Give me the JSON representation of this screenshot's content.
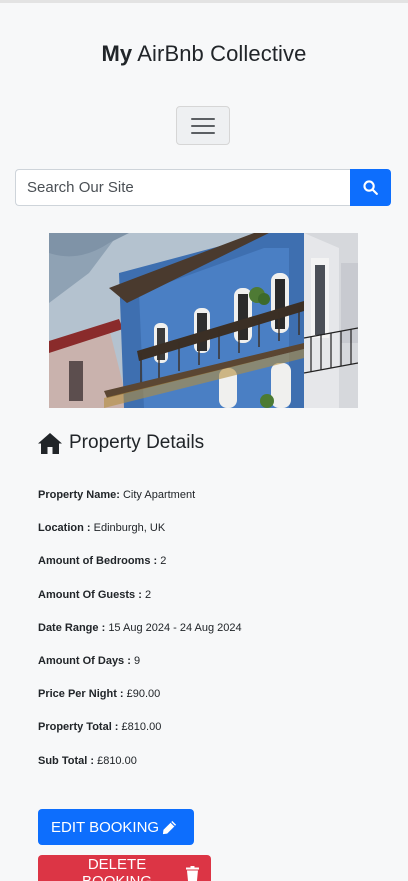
{
  "header": {
    "brand_bold": "My",
    "brand_rest": "AirBnb Collective",
    "menu_icon": "hamburger-menu-icon"
  },
  "search": {
    "placeholder": "Search Our Site",
    "button_icon": "search-icon",
    "button_color": "#0d6efd"
  },
  "property": {
    "heading_icon": "home-icon",
    "heading": "Property Details",
    "details": [
      {
        "label": "Property Name:",
        "value": "City Apartment"
      },
      {
        "label": "Location :",
        "value": "Edinburgh, UK"
      },
      {
        "label": "Amount of Bedrooms :",
        "value": "2"
      },
      {
        "label": "Amount Of Guests :",
        "value": "2"
      },
      {
        "label": "Date Range :",
        "value": "15 Aug 2024 - 24 Aug 2024"
      },
      {
        "label": "Amount Of Days :",
        "value": "9"
      },
      {
        "label": "Price Per Night :",
        "value": "£90.00"
      },
      {
        "label": "Property Total :",
        "value": "£810.00"
      },
      {
        "label": "Sub Total :",
        "value": "£810.00"
      }
    ]
  },
  "actions": {
    "edit_label": "EDIT BOOKING",
    "edit_icon": "pencil-icon",
    "edit_color": "#0d6efd",
    "delete_label": "DELETE BOOKING",
    "delete_icon": "trash-icon",
    "delete_color": "#dc3545"
  }
}
